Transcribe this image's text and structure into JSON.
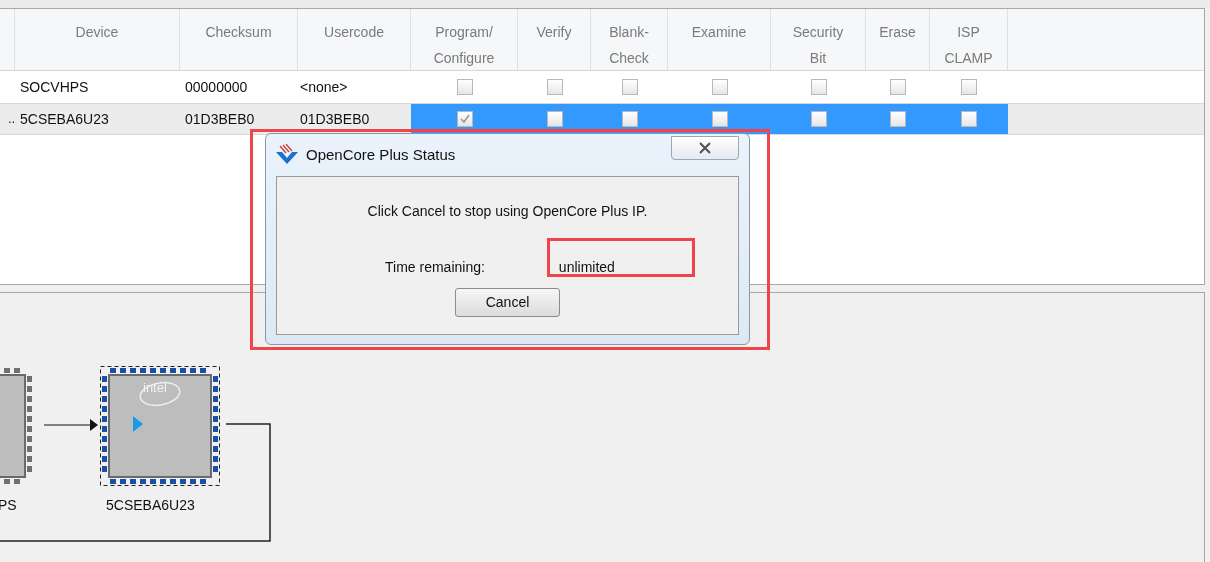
{
  "table": {
    "columns": [
      "",
      "Device",
      "Checksum",
      "Usercode",
      "Program/\nConfigure",
      "Verify",
      "Blank-\nCheck",
      "Examine",
      "Security\nBit",
      "Erase",
      "ISP\nCLAMP"
    ],
    "rows": [
      {
        "lead": "",
        "device": "SOCVHPS",
        "checksum": "00000000",
        "usercode": "<none>",
        "selected": false,
        "checks": [
          {
            "checked": false
          },
          {
            "checked": false
          },
          {
            "checked": false
          },
          {
            "checked": false
          },
          {
            "checked": false
          },
          {
            "checked": false
          },
          {
            "checked": false
          }
        ]
      },
      {
        "lead": "..",
        "device": "5CSEBA6U23",
        "checksum": "01D3BEB0",
        "usercode": "01D3BEB0",
        "selected": true,
        "checks": [
          {
            "checked": true
          },
          {
            "checked": false
          },
          {
            "checked": false
          },
          {
            "checked": false
          },
          {
            "checked": false
          },
          {
            "checked": false
          },
          {
            "checked": false
          }
        ]
      }
    ]
  },
  "chain": {
    "devices": [
      {
        "label": "PS",
        "selected": false
      },
      {
        "label": "5CSEBA6U23",
        "selected": true,
        "logo": "intel"
      }
    ]
  },
  "dialog": {
    "title": "OpenCore Plus Status",
    "message": "Click Cancel to stop using OpenCore Plus IP.",
    "time_label": "Time remaining:",
    "time_value": "unlimited",
    "button": "Cancel"
  }
}
